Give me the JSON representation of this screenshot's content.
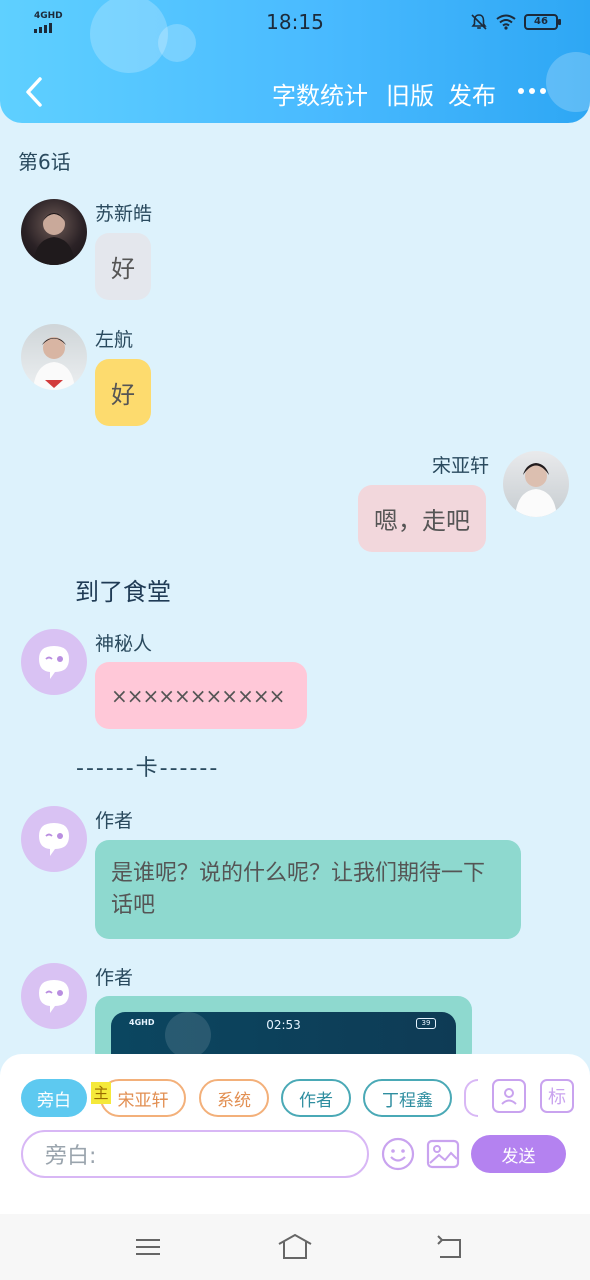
{
  "status_bar": {
    "network": "4GHD",
    "time": "18:15",
    "battery": "46"
  },
  "header": {
    "actions": {
      "word_count": "字数统计",
      "old_version": "旧版",
      "publish": "发布"
    }
  },
  "chapter_title": "第6话",
  "messages": [
    {
      "speaker": "苏新皓",
      "text": "好",
      "side": "left",
      "bubble_color": "#e4e7ed"
    },
    {
      "speaker": "左航",
      "text": "好",
      "side": "left",
      "bubble_color": "#fddb6e"
    },
    {
      "speaker": "宋亚轩",
      "text": "嗯，走吧",
      "side": "right",
      "bubble_color": "#f2d7dc"
    },
    {
      "narration": "到了食堂"
    },
    {
      "speaker": "神秘人",
      "text": "×××××××××××",
      "side": "left",
      "bubble_color": "#ffc8d8"
    },
    {
      "divider": "------卡------"
    },
    {
      "speaker": "作者",
      "text": "是谁呢？说的什么呢？让我们期待一下话吧",
      "side": "left",
      "bubble_color": "#8ed9cf"
    },
    {
      "speaker": "作者",
      "image": {
        "time": "02:53",
        "network": "4GHD",
        "battery": "39"
      },
      "side": "left",
      "bubble_color": "#8ed9cf"
    }
  ],
  "composer": {
    "roles": [
      "旁白",
      "宋亚轩",
      "系统",
      "作者",
      "丁程鑫"
    ],
    "main_tag": "主",
    "mark_icon_label": "标",
    "input_placeholder": "旁白:",
    "send_label": "发送"
  },
  "colors": {
    "header_gradient_start": "#5fd0ff",
    "header_gradient_end": "#2ea7f4",
    "background": "#ddf2fc",
    "accent_purple": "#b482f0"
  }
}
